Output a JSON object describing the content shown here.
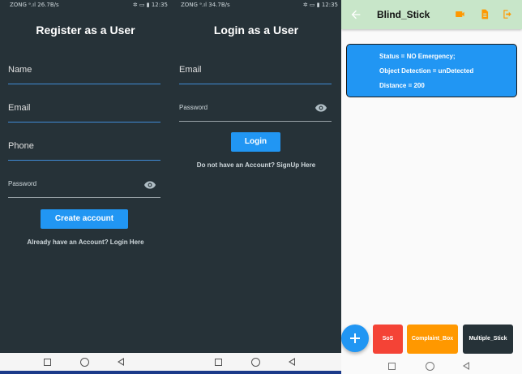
{
  "phone1": {
    "status": {
      "left": "ZONG ᵃ.ıl 26.7B/s",
      "right": "✲ ▭ ▮ 12:35"
    },
    "title": "Register as a User",
    "fields": {
      "name": "Name",
      "email": "Email",
      "phone": "Phone",
      "password": "Password"
    },
    "button": "Create account",
    "hint": "Already have an Account? Login Here"
  },
  "phone2": {
    "status": {
      "left": "ZONG ᵃ.ıl 34.7B/s",
      "right": "✲ ▭ ▮ 12:35"
    },
    "title": "Login as a User",
    "fields": {
      "email": "Email",
      "password": "Password"
    },
    "button": "Login",
    "hint": "Do not have an Account? SignUp Here"
  },
  "app": {
    "title": "Blind_Stick",
    "icons": [
      "back-arrow-icon",
      "video-camera-icon",
      "document-icon",
      "logout-icon"
    ],
    "status_lines": [
      "Status = NO Emergency;",
      "Object Detection = unDetected",
      "Distance = 200"
    ],
    "buttons": {
      "sos": "SoS",
      "complaint": "Complaint_Box",
      "multiple": "Multiple_Stick"
    },
    "colors": {
      "appbar": "#c8e6c9",
      "accent": "#2196f3",
      "sos": "#f44336",
      "complaint": "#ff9800",
      "multiple": "#263238",
      "icons": "#ff9800"
    }
  }
}
